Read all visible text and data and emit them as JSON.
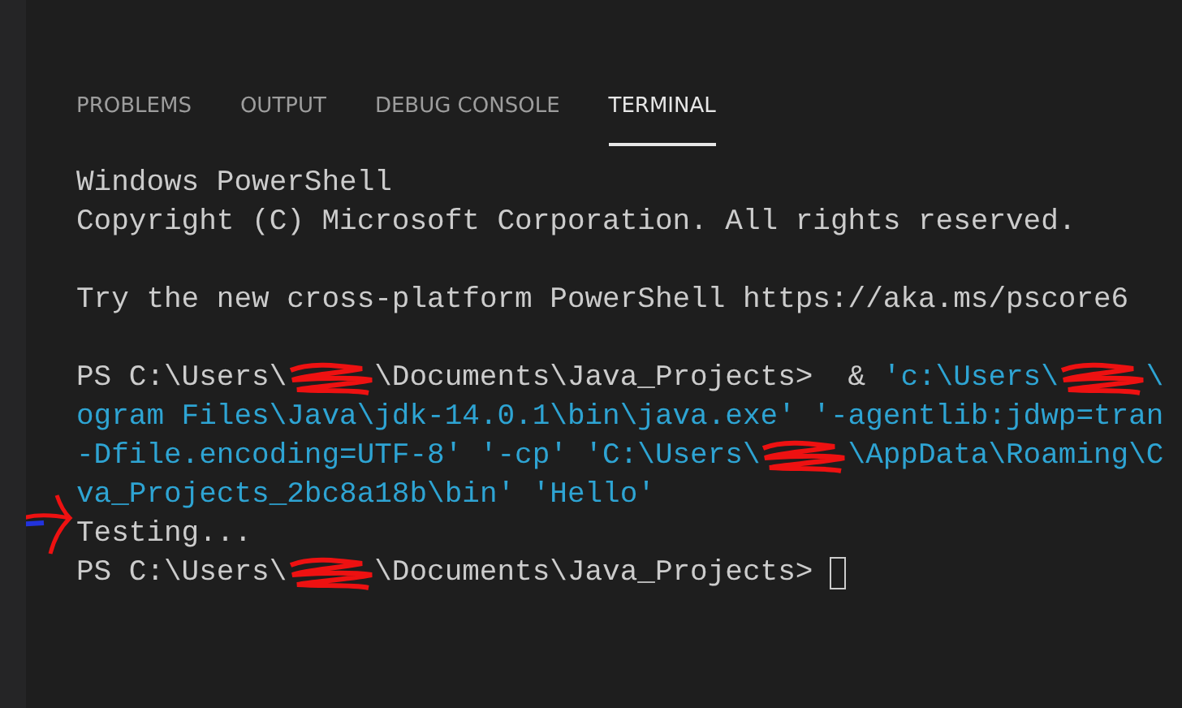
{
  "panel": {
    "tabs": [
      {
        "label": "PROBLEMS",
        "selected": false
      },
      {
        "label": "OUTPUT",
        "selected": false
      },
      {
        "label": "DEBUG CONSOLE",
        "selected": false
      },
      {
        "label": "TERMINAL",
        "selected": true
      }
    ]
  },
  "terminal": {
    "lines": [
      {
        "kind": "output",
        "segments": [
          {
            "kind": "plain",
            "text": "Windows PowerShell"
          }
        ]
      },
      {
        "kind": "output",
        "segments": [
          {
            "kind": "plain",
            "text": "Copyright (C) Microsoft Corporation. All rights reserved."
          }
        ]
      },
      {
        "kind": "blank"
      },
      {
        "kind": "output",
        "segments": [
          {
            "kind": "plain",
            "text": "Try the new cross-platform PowerShell https://aka.ms/pscore6"
          }
        ]
      },
      {
        "kind": "blank"
      },
      {
        "kind": "output",
        "segments": [
          {
            "kind": "plain",
            "text": "PS C:\\Users\\"
          },
          {
            "kind": "redacted"
          },
          {
            "kind": "plain",
            "text": "\\Documents\\Java_Projects>  & "
          },
          {
            "kind": "string",
            "text": "'c:\\Users\\"
          },
          {
            "kind": "redacted"
          },
          {
            "kind": "string",
            "text": "\\"
          }
        ]
      },
      {
        "kind": "output",
        "segments": [
          {
            "kind": "string",
            "text": "ogram Files\\Java\\jdk-14.0.1\\bin\\java.exe' '-agentlib:jdwp=tran"
          }
        ]
      },
      {
        "kind": "output",
        "segments": [
          {
            "kind": "string",
            "text": "-Dfile.encoding=UTF-8' '-cp' 'C:\\Users\\"
          },
          {
            "kind": "redacted"
          },
          {
            "kind": "string",
            "text": "\\AppData\\Roaming\\C"
          }
        ]
      },
      {
        "kind": "output",
        "segments": [
          {
            "kind": "string",
            "text": "va_Projects_2bc8a18b\\bin' 'Hello'"
          }
        ]
      },
      {
        "kind": "output",
        "annotated": true,
        "segments": [
          {
            "kind": "plain",
            "text": "Testing..."
          }
        ]
      },
      {
        "kind": "output",
        "segments": [
          {
            "kind": "plain",
            "text": "PS C:\\Users\\"
          },
          {
            "kind": "redacted"
          },
          {
            "kind": "plain",
            "text": "\\Documents\\Java_Projects> "
          },
          {
            "kind": "cursor"
          }
        ]
      }
    ]
  }
}
